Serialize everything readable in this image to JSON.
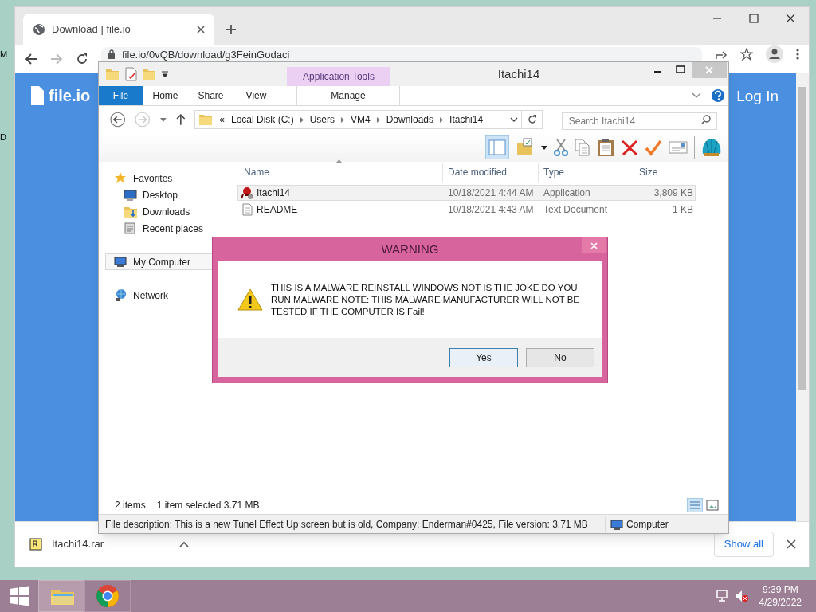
{
  "desktop": {
    "icon_labels": [
      "M",
      "D"
    ]
  },
  "browser": {
    "tab": {
      "title": "Download | file.io"
    },
    "url": "file.io/0vQB/download/g3FeinGodaci",
    "page": {
      "logo": "file.io",
      "login": "Log In"
    },
    "download": {
      "filename": "Itachi14.rar",
      "show_all": "Show all"
    }
  },
  "explorer": {
    "title": "Itachi14",
    "context_tab": "Application Tools",
    "ribbon_tabs": [
      {
        "label": "File",
        "kind": "file"
      },
      {
        "label": "Home",
        "kind": "tab"
      },
      {
        "label": "Share",
        "kind": "tab"
      },
      {
        "label": "View",
        "kind": "tab"
      },
      {
        "label": "Manage",
        "kind": "context"
      }
    ],
    "breadcrumb_overflow": "«",
    "breadcrumb": [
      "Local Disk (C:)",
      "Users",
      "VM4",
      "Downloads",
      "Itachi14"
    ],
    "search": {
      "placeholder": "Search Itachi14"
    },
    "nav": [
      {
        "label": "Favorites",
        "kind": "favorites",
        "selected": false,
        "children": [
          {
            "label": "Desktop",
            "kind": "desktop",
            "selected": false
          },
          {
            "label": "Downloads",
            "kind": "downloads",
            "selected": false
          },
          {
            "label": "Recent places",
            "kind": "recent",
            "selected": false
          }
        ]
      },
      {
        "label": "My Computer",
        "kind": "computer",
        "selected": true
      },
      {
        "label": "Network",
        "kind": "network",
        "selected": false
      }
    ],
    "columns": [
      "Name",
      "Date modified",
      "Type",
      "Size"
    ],
    "rows": [
      {
        "name": "Itachi14",
        "date": "10/18/2021 4:44 AM",
        "type": "Application",
        "size": "3,809 KB",
        "kind": "application",
        "selected": true
      },
      {
        "name": "README",
        "date": "10/18/2021 4:43 AM",
        "type": "Text Document",
        "size": "1 KB",
        "kind": "text",
        "selected": false
      }
    ],
    "status": {
      "count": "2 items",
      "selection": "1 item selected  3.71 MB"
    },
    "details": {
      "description": "File description: This is a new Tunel Effect Up screen but is old, Company: Enderman#0425, File version: 3.71 MB",
      "location": "Computer"
    }
  },
  "dialog": {
    "title": "WARNING",
    "message": "THIS IS A MALWARE REINSTALL WINDOWS NOT IS THE JOKE  DO YOU RUN MALWARE NOTE: THIS MALWARE MANUFACTURER WILL NOT BE TESTED IF THE COMPUTER IS Fail!",
    "buttons": [
      {
        "label": "Yes",
        "default": true
      },
      {
        "label": "No",
        "default": false
      }
    ]
  },
  "taskbar": {
    "apps": [
      {
        "kind": "explorer",
        "active": true
      },
      {
        "kind": "chrome",
        "active": false
      }
    ],
    "time": "9:39 PM",
    "date": "4/29/2022"
  }
}
